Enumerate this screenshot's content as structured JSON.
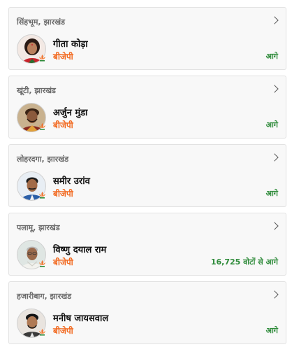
{
  "results": [
    {
      "constituency": "सिंहभूम, झारखंड",
      "candidate": "गीता कोड़ा",
      "party": "बीजेपी",
      "status": "आगे",
      "avatar": "candidate-photo",
      "party_icon": "lotus-icon"
    },
    {
      "constituency": "खूंटी, झारखंड",
      "candidate": "अर्जुन मुंडा",
      "party": "बीजेपी",
      "status": "आगे",
      "avatar": "candidate-photo",
      "party_icon": "lotus-icon"
    },
    {
      "constituency": "लोहरदगा, झारखंड",
      "candidate": "समीर उरांव",
      "party": "बीजेपी",
      "status": "आगे",
      "avatar": "candidate-photo",
      "party_icon": "lotus-icon"
    },
    {
      "constituency": "पलामू, झारखंड",
      "candidate": "विष्णु दयाल राम",
      "party": "बीजेपी",
      "status": "16,725 वोटों से आगे",
      "avatar": "candidate-photo",
      "party_icon": "lotus-icon"
    },
    {
      "constituency": "हजारीबाग, झारखंड",
      "candidate": "मनीष जायसवाल",
      "party": "बीजेपी",
      "status": "आगे",
      "avatar": "candidate-photo",
      "party_icon": "lotus-icon"
    }
  ],
  "colors": {
    "party": "#f26a21",
    "status": "#2e8b3a",
    "card_bg": "#f8f8f8",
    "constituency": "#6b6b6b"
  }
}
